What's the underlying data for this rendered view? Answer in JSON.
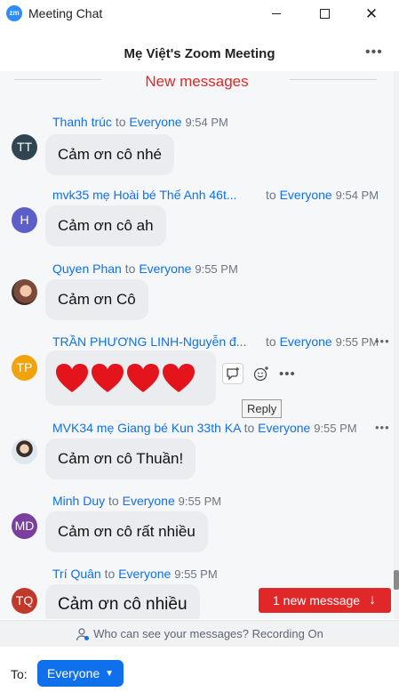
{
  "window": {
    "app_title": "Meeting Chat",
    "logo_text": "zm"
  },
  "header": {
    "title": "Mẹ Việt's Zoom Meeting"
  },
  "chat": {
    "divider_label": "New messages",
    "messages": [
      {
        "sender": "Thanh trúc",
        "to_word": "to",
        "target": "Everyone",
        "time": "9:54 PM",
        "avatar_initials": "TT",
        "avatar_color": "#2F4552",
        "text": "Cảm ơn cô nhé"
      },
      {
        "sender": "mvk35 mẹ Hoài bé Thế Anh 46t...",
        "to_word": "to",
        "target": "Everyone",
        "time": "9:54 PM",
        "avatar_initials": "H",
        "avatar_color": "#5B5FC7",
        "text": "Cảm ơn cô ah"
      },
      {
        "sender": "Quyen Phan",
        "to_word": "to",
        "target": "Everyone",
        "time": "9:55 PM",
        "avatar_initials": "",
        "avatar_color": "#7a4b3a",
        "text": "Cảm ơn Cô"
      },
      {
        "sender": "TRẦN PHƯƠNG LINH-Nguyễn đ...",
        "to_word": "to",
        "target": "Everyone",
        "time": "9:55 PM",
        "avatar_initials": "TP",
        "avatar_color": "#F0A30A",
        "text": ""
      },
      {
        "sender": "MVK34 mẹ Giang bé Kun 33th KA",
        "to_word": "to",
        "target": "Everyone",
        "time": "9:55 PM",
        "avatar_initials": "",
        "avatar_color": "#c9d6e0",
        "text": "Cảm ơn cô Thuần!"
      },
      {
        "sender": "Minh Duy",
        "to_word": "to",
        "target": "Everyone",
        "time": "9:55 PM",
        "avatar_initials": "MD",
        "avatar_color": "#7B3FA0",
        "text": "Cảm ơn cô rất nhiều"
      },
      {
        "sender": "Trí Quân",
        "to_word": "to",
        "target": "Everyone",
        "time": "9:55 PM",
        "avatar_initials": "TQ",
        "avatar_color": "#C0392B",
        "text": "Cảm ơn cô nhiều"
      }
    ],
    "reply_tooltip": "Reply",
    "new_message_button": "1 new message"
  },
  "footer": {
    "notice": "Who can see your messages? Recording On",
    "to_label": "To:",
    "recipient": "Everyone"
  },
  "colors": {
    "accent": "#0E71EB",
    "alert": "#E02828",
    "zoom_blue": "#2D8CFF"
  },
  "icons": [
    "zoom-logo-icon",
    "minimize-icon",
    "maximize-icon",
    "close-icon",
    "more-icon",
    "reply-icon",
    "emoji-reaction-icon",
    "heart-icon",
    "arrow-down-icon",
    "person-icon",
    "chevron-down-icon"
  ]
}
